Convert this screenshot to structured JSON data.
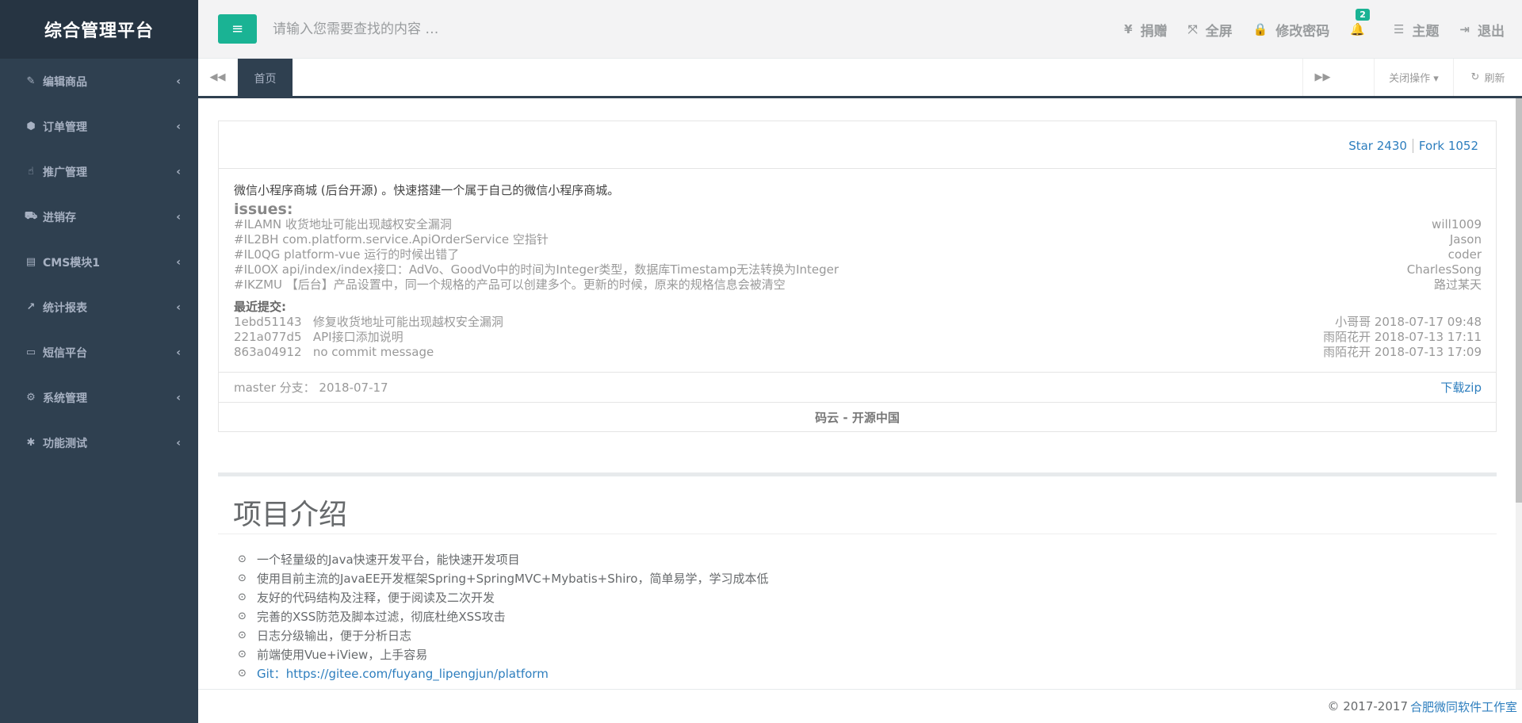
{
  "sidebar": {
    "brand": "综合管理平台",
    "items": [
      {
        "label": "编辑商品",
        "icon": "✎"
      },
      {
        "label": "订单管理",
        "icon": "⬢"
      },
      {
        "label": "推广管理",
        "icon": "☝"
      },
      {
        "label": "进销存",
        "icon": "⛟"
      },
      {
        "label": "CMS模块1",
        "icon": "▤"
      },
      {
        "label": "统计报表",
        "icon": "↗"
      },
      {
        "label": "短信平台",
        "icon": "▭"
      },
      {
        "label": "系统管理",
        "icon": "⚙"
      },
      {
        "label": "功能测试",
        "icon": "✱"
      }
    ],
    "chevron": "‹"
  },
  "header": {
    "menu_icon": "≡",
    "search_placeholder": "请输入您需要查找的内容 …",
    "donate": {
      "label": "捐赠",
      "icon": "¥"
    },
    "fullscreen": {
      "label": "全屏",
      "icon": "⤧"
    },
    "password": {
      "label": "修改密码",
      "icon": "🔒"
    },
    "notifications": {
      "icon": "🔔",
      "count": "2"
    },
    "theme": {
      "label": "主题",
      "icon": "☰"
    },
    "logout": {
      "label": "退出",
      "icon": "⇥"
    }
  },
  "tabs": {
    "prev_icon": "◀◀",
    "active": "首页",
    "next_icon": "▶▶",
    "close_ops": "关闭操作 ▾",
    "refresh": {
      "label": "刷新",
      "icon": "↻"
    }
  },
  "gitee": {
    "star": "Star 2430",
    "fork": "Fork 1052",
    "description": "微信小程序商城 (后台开源) 。快速搭建一个属于自己的微信小程序商城。",
    "issues_title": "issues:",
    "issues": [
      {
        "title": "#ILAMN 收货地址可能出现越权安全漏洞",
        "author": "will1009"
      },
      {
        "title": "#IL2BH com.platform.service.ApiOrderService 空指针",
        "author": "Jason"
      },
      {
        "title": "#IL0QG platform-vue 运行的时候出错了",
        "author": "coder"
      },
      {
        "title": "#IL0OX api/index/index接口：AdVo、GoodVo中的时间为Integer类型，数据库Timestamp无法转换为Integer",
        "author": "CharlesSong"
      },
      {
        "title": "#IKZMU 【后台】产品设置中，同一个规格的产品可以创建多个。更新的时候，原来的规格信息会被清空",
        "author": "路过某天"
      }
    ],
    "commits_title": "最近提交:",
    "commits": [
      {
        "hash": "1ebd51143",
        "message": "修复收货地址可能出现越权安全漏洞",
        "meta": "小哥哥 2018-07-17 09:48"
      },
      {
        "hash": "221a077d5",
        "message": "API接口添加说明",
        "meta": "雨陌花开 2018-07-13 17:11"
      },
      {
        "hash": "863a04912",
        "message": "no commit message",
        "meta": "雨陌花开 2018-07-13 17:09"
      }
    ],
    "branch": "master 分支： 2018-07-17",
    "download": "下载zip",
    "brand": "码云 - 开源中国"
  },
  "intro": {
    "title": "项目介绍",
    "bullet_icon": "⊙",
    "items": [
      "一个轻量级的Java快速开发平台，能快速开发项目",
      "使用目前主流的JavaEE开发框架Spring+SpringMVC+Mybatis+Shiro，简单易学，学习成本低",
      "友好的代码结构及注释，便于阅读及二次开发",
      "完善的XSS防范及脚本过滤，彻底杜绝XSS攻击",
      "日志分级输出，便于分析日志",
      "前端使用Vue+iView，上手容易"
    ],
    "git_prefix": "Git：",
    "git_link": "https://gitee.com/fuyang_lipengjun/platform"
  },
  "footer": {
    "copyright": "© 2017-2017",
    "org": "合肥微同软件工作室"
  }
}
